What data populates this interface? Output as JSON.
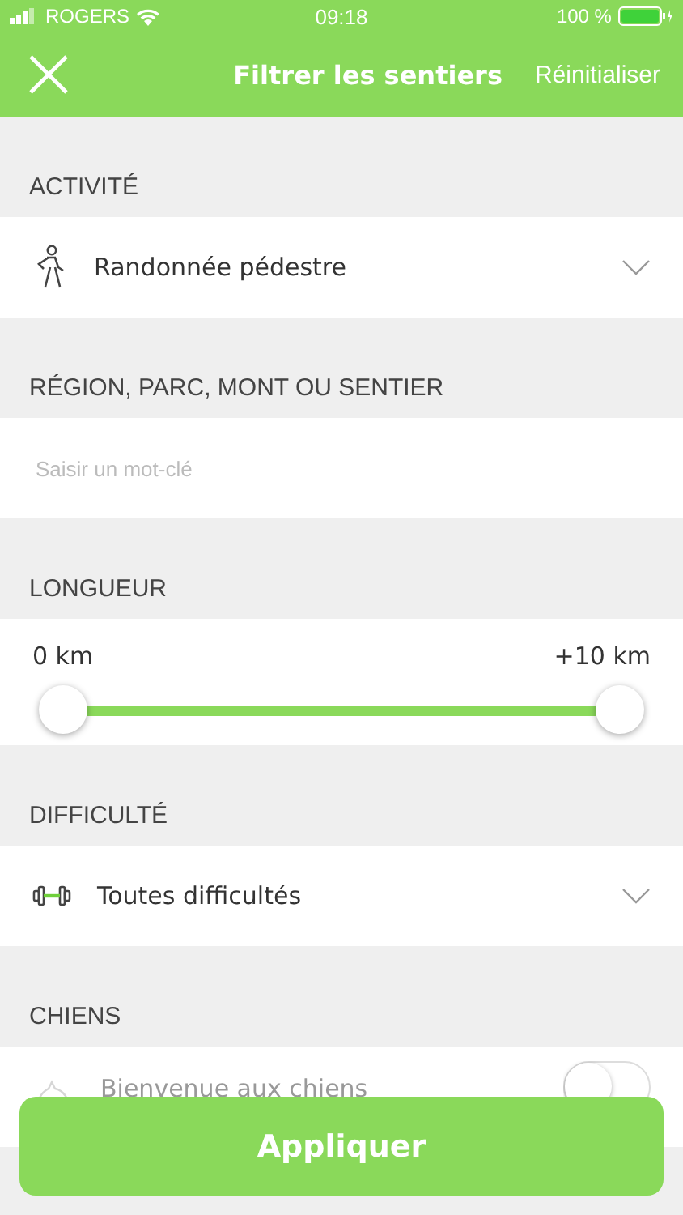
{
  "status_bar": {
    "carrier": "ROGERS",
    "time": "09:18",
    "battery": "100 %"
  },
  "nav": {
    "title": "Filtrer les sentiers",
    "reset": "Réinitialiser"
  },
  "sections": [
    {
      "kind": "select",
      "header": "ACTIVITÉ",
      "value": "Randonnée pédestre"
    },
    {
      "kind": "input",
      "header": "RÉGION, PARC, MONT OU SENTIER",
      "placeholder": "Saisir un mot-clé"
    },
    {
      "kind": "range",
      "header": "LONGUEUR",
      "thumbs": [
        {
          "label": "0 km",
          "level": 0
        },
        {
          "label": "+10 km",
          "level": 1
        }
      ]
    },
    {
      "kind": "select",
      "header": "DIFFICULTÉ",
      "value": "Toutes difficultés"
    },
    {
      "kind": "toggle",
      "header": "CHIENS",
      "label": "Bienvenue aux chiens",
      "on": false
    }
  ],
  "apply_button": "Appliquer"
}
